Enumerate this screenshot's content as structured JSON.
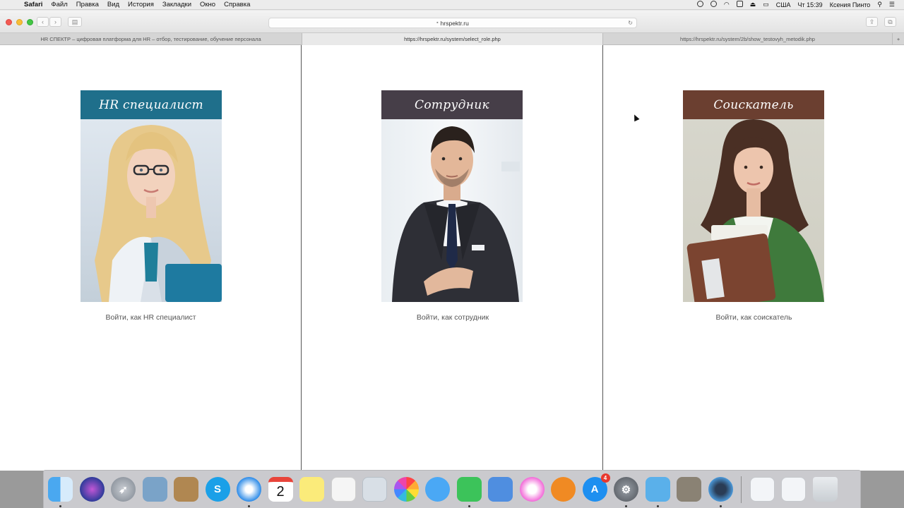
{
  "menubar": {
    "app_name": "Safari",
    "items": [
      "Файл",
      "Правка",
      "Вид",
      "История",
      "Закладки",
      "Окно",
      "Справка"
    ],
    "input_source": "США",
    "clock": "Чт 15:39",
    "user": "Ксения Пинто"
  },
  "toolbar": {
    "url": "hrspektr.ru"
  },
  "tabs": [
    {
      "label": "HR СПЕКТР – цифровая платформа для HR – отбор, тестирование, обучение персонала"
    },
    {
      "label": "https://hrspektr.ru/system/select_role.php"
    },
    {
      "label": "https://hrspektr.ru/system/2b/show_testovyh_metodik.php"
    }
  ],
  "roles": [
    {
      "title": "HR специалист",
      "link": "Войти, как HR специалист",
      "color": "#1f6f8b"
    },
    {
      "title": "Сотрудник",
      "link": "Войти, как сотрудник",
      "color": "#463e48"
    },
    {
      "title": "Соискатель",
      "link": "Войти, как соискатель",
      "color": "#6b3f30"
    }
  ],
  "dock": {
    "calendar_day": "2",
    "app_store_badge": "4",
    "icons": [
      "finder-icon",
      "siri-icon",
      "launchpad-icon",
      "preview-icon",
      "notes-book-icon",
      "skype-icon",
      "safari-icon",
      "calendar-icon",
      "stickies-icon",
      "reminders-icon",
      "photo-booth-icon",
      "photos-icon",
      "messages-icon",
      "facetime-icon",
      "keynote-icon",
      "itunes-icon",
      "ibooks-icon",
      "app-store-icon",
      "system-preferences-icon",
      "mail-icon",
      "gimp-icon",
      "quicktime-icon",
      "downloads-stack-icon",
      "documents-stack-icon",
      "trash-icon"
    ]
  }
}
